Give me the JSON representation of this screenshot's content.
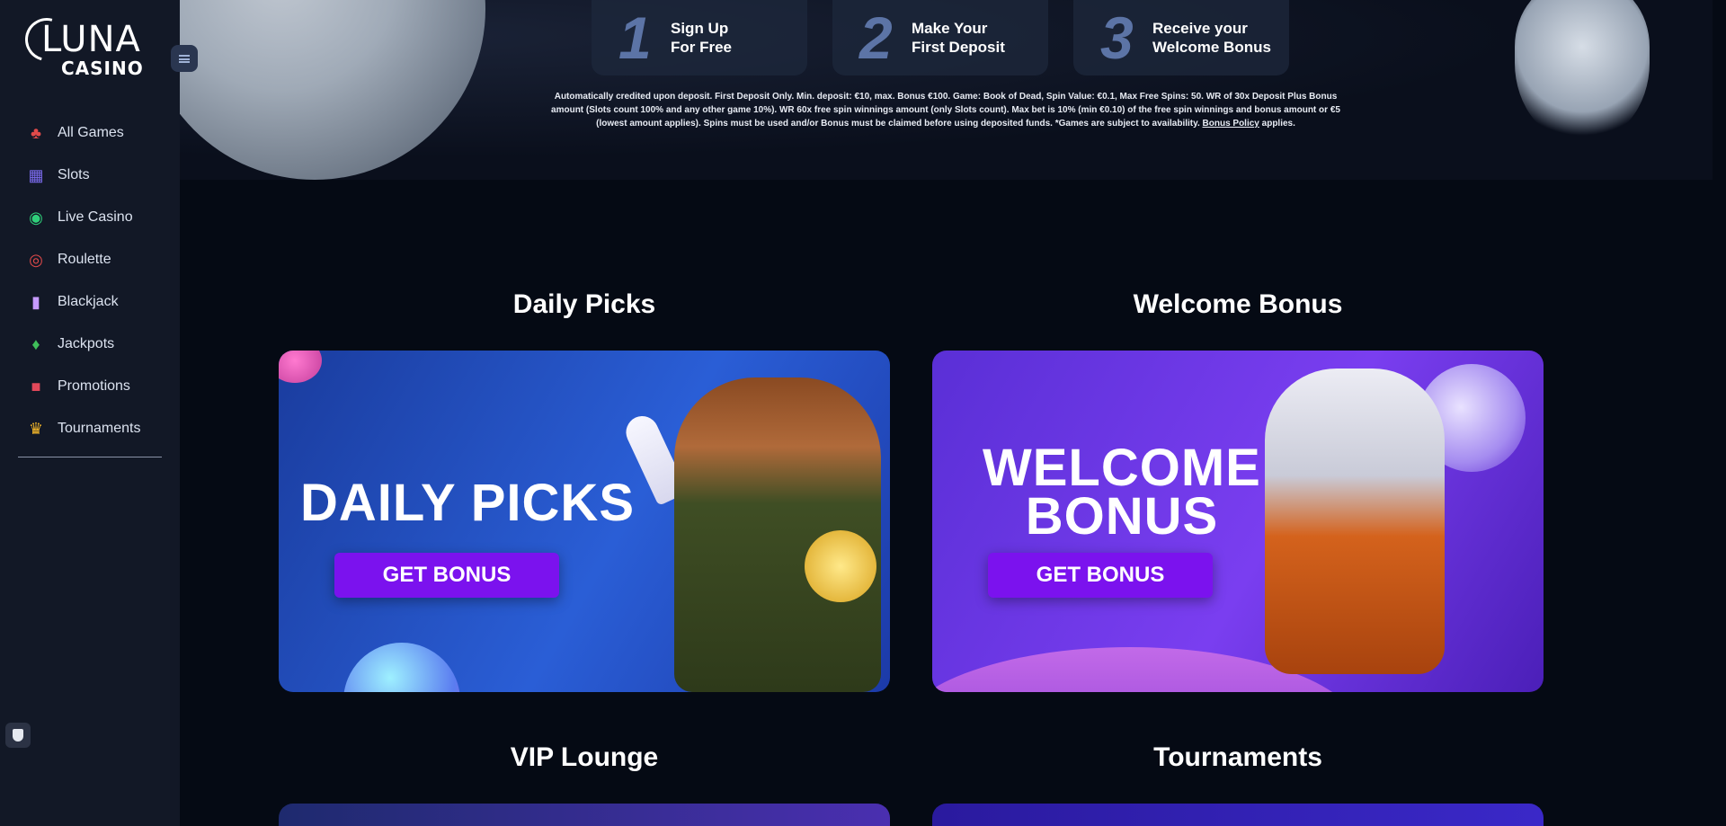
{
  "brand": {
    "logo_main": "LUNA",
    "logo_sub": "CASINO"
  },
  "sidebar": {
    "toggle_icon": "menu-icon",
    "items": [
      {
        "label": "All Games",
        "icon": "cards-suits-icon",
        "glyph": "♣",
        "color": "#e24a4a"
      },
      {
        "label": "Slots",
        "icon": "slot-machine-icon",
        "glyph": "▦",
        "color": "#7c6cf0"
      },
      {
        "label": "Live Casino",
        "icon": "live-dealer-icon",
        "glyph": "◉",
        "color": "#2fcf7a"
      },
      {
        "label": "Roulette",
        "icon": "roulette-icon",
        "glyph": "◎",
        "color": "#e24a4a"
      },
      {
        "label": "Blackjack",
        "icon": "blackjack-cards-icon",
        "glyph": "▮",
        "color": "#c69aff"
      },
      {
        "label": "Jackpots",
        "icon": "money-bag-icon",
        "glyph": "♦",
        "color": "#3fbf5a"
      },
      {
        "label": "Promotions",
        "icon": "gift-icon",
        "glyph": "■",
        "color": "#e2485a"
      },
      {
        "label": "Tournaments",
        "icon": "trophy-icon",
        "glyph": "♛",
        "color": "#f0b429"
      }
    ]
  },
  "hero": {
    "steps": [
      {
        "number": "1",
        "line1": "Sign Up",
        "line2": "For Free"
      },
      {
        "number": "2",
        "line1": "Make Your",
        "line2": "First Deposit"
      },
      {
        "number": "3",
        "line1": "Receive your",
        "line2": "Welcome Bonus"
      }
    ],
    "disclaimer": "Automatically credited upon deposit. First Deposit Only. Min. deposit: €10, max. Bonus €100. Game: Book of Dead, Spin Value: €0.1, Max Free Spins: 50. WR of 30x Deposit Plus Bonus amount (Slots count 100% and any other game 10%). WR 60x free spin winnings amount (only Slots count). Max bet is 10% (min €0.10) of the free spin winnings and bonus amount or €5 (lowest amount applies). Spins must be used and/or Bonus must be claimed before using deposited funds. *Games are subject to availability. ",
    "disclaimer_link": "Bonus Policy",
    "disclaimer_tail": " applies."
  },
  "sections": {
    "daily_title": "Daily Picks",
    "welcome_title": "Welcome Bonus",
    "vip_title": "VIP Lounge",
    "tournaments_title": "Tournaments"
  },
  "cards": {
    "daily": {
      "headline": "DAILY PICKS",
      "button": "GET BONUS"
    },
    "welcome": {
      "headline_line1": "WELCOME",
      "headline_line2": "BONUS",
      "button": "GET BONUS"
    }
  }
}
